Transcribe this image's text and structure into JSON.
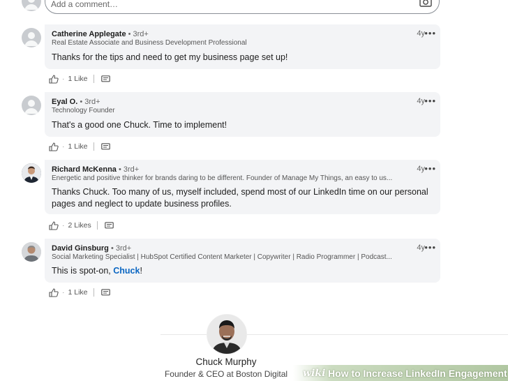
{
  "composer": {
    "placeholder": "Add a comment…",
    "camera_icon": "camera-icon"
  },
  "comments": [
    {
      "name": "Catherine Applegate",
      "degree": " • 3rd+",
      "headline": "Real Estate Associate and Business Development Professional",
      "time": "4y",
      "text": "Thanks for the tips and need to get my business page set up!",
      "likes": "1 Like"
    },
    {
      "name": "Eyal O.",
      "degree": " • 3rd+",
      "headline": "Technology Founder",
      "time": "4y",
      "text": "That's a good one Chuck. Time to implement!",
      "likes": "1 Like"
    },
    {
      "name": "Richard McKenna",
      "degree": " • 3rd+",
      "headline": "Energetic and positive thinker for brands daring to be different. Founder of Manage My Things, an easy to us...",
      "time": "4y",
      "text": "Thanks Chuck.  Too many of us, myself included, spend most of our LinkedIn time on our personal pages and neglect to update business profiles.",
      "likes": "2 Likes"
    },
    {
      "name": "David Ginsburg",
      "degree": " • 3rd+",
      "headline": "Social Marketing Specialist | HubSpot Certified Content Marketer | Copywriter | Radio Programmer | Podcast...",
      "time": "4y",
      "text_prefix": "This is spot-on, ",
      "mention": "Chuck",
      "text_suffix": "!",
      "likes": "1 Like"
    }
  ],
  "author": {
    "name": "Chuck Murphy",
    "title": "Founder & CEO at Boston Digital"
  },
  "watermark": {
    "logo": "wiki",
    "title": "How to Increase LinkedIn Engagement"
  },
  "icons": {
    "more": "more-options-icon",
    "like": "thumbs-up-icon",
    "reply": "reply-icon",
    "avatar": "user-avatar-icon"
  }
}
